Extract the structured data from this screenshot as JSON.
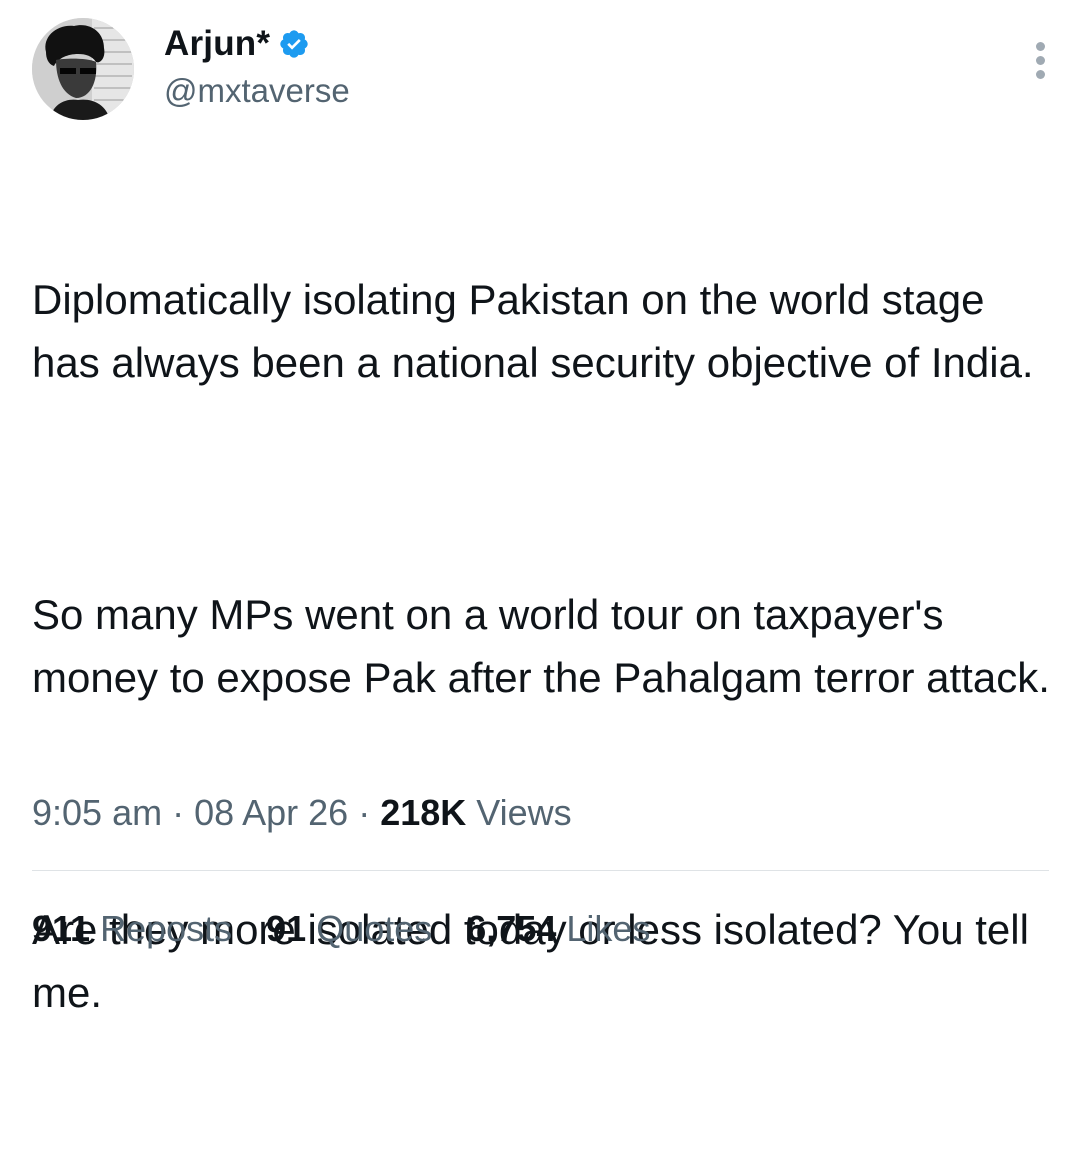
{
  "author": {
    "display_name": "Arjun*",
    "handle": "@mxtaverse",
    "verified_color": "#1d9bf0"
  },
  "icons": {
    "avatar": "avatar-image",
    "verified": "verified-badge-icon",
    "more": "more-options-icon"
  },
  "tweet": {
    "paragraphs": [
      "Diplomatically isolating Pakistan on the world stage has always been a national security objective of India.",
      "So many MPs went on a world tour on taxpayer's money to expose Pak after the Pahalgam terror attack.",
      "Are they more isolated today or less isolated? You tell me."
    ]
  },
  "meta": {
    "time": "9:05 am",
    "sep1": " · ",
    "date": "08 Apr 26",
    "sep2": " · ",
    "views_count": "218K",
    "views_label": " Views"
  },
  "stats": {
    "reposts_count": "911",
    "reposts_label": " Reposts",
    "quotes_count": "91",
    "quotes_label": " Quotes",
    "likes_count": "6,754",
    "likes_label": " Likes"
  }
}
